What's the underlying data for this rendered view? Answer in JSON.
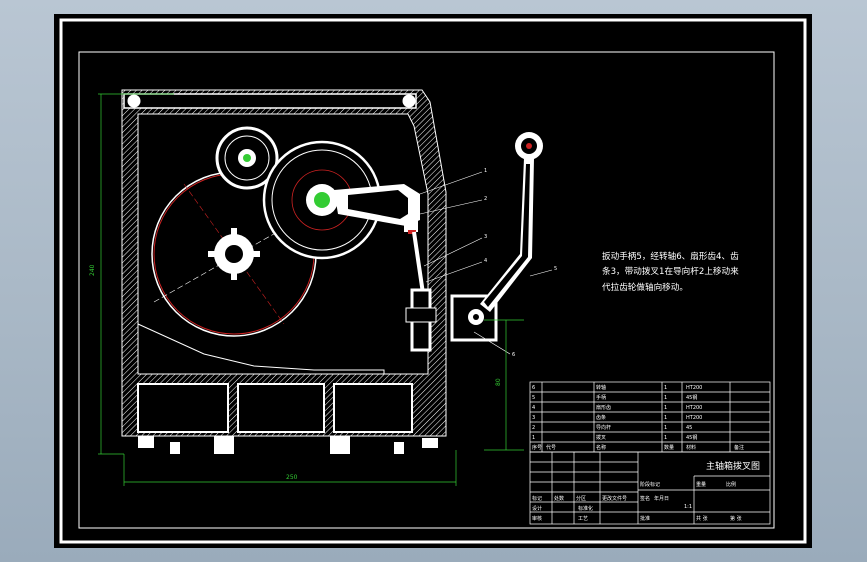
{
  "drawing": {
    "note_lines": [
      "扳动手柄5，经转轴6、扇形齿4、齿",
      "条3，带动拨叉1在导向杆2上移动来",
      "代拉齿轮做轴向移动。"
    ],
    "title": "主轴箱拨叉图",
    "scale": "1:1",
    "leaders": [
      "1",
      "2",
      "3",
      "4",
      "5",
      "6"
    ],
    "parts_list": [
      {
        "no": "6",
        "name": "转轴",
        "qty": "1",
        "mat": "HT200"
      },
      {
        "no": "5",
        "name": "手柄",
        "qty": "1",
        "mat": "45钢"
      },
      {
        "no": "4",
        "name": "扇形齿",
        "qty": "1",
        "mat": "HT200"
      },
      {
        "no": "3",
        "name": "齿条",
        "qty": "1",
        "mat": "HT200"
      },
      {
        "no": "2",
        "name": "导向杆",
        "qty": "1",
        "mat": "45"
      },
      {
        "no": "1",
        "name": "拨叉",
        "qty": "1",
        "mat": "45钢"
      }
    ],
    "parts_header": [
      "序号",
      "代号",
      "名称",
      "数量",
      "材料",
      "备注"
    ],
    "title_block": {
      "labels": [
        "标记",
        "处数",
        "分区",
        "更改文件号",
        "签名",
        "年月日",
        "设计",
        "标准化",
        "阶段标记",
        "重量",
        "比例",
        "审核",
        "工艺",
        "批准",
        "共 张",
        "第 张"
      ]
    },
    "dimensions": [
      "240",
      "250",
      "80"
    ]
  }
}
